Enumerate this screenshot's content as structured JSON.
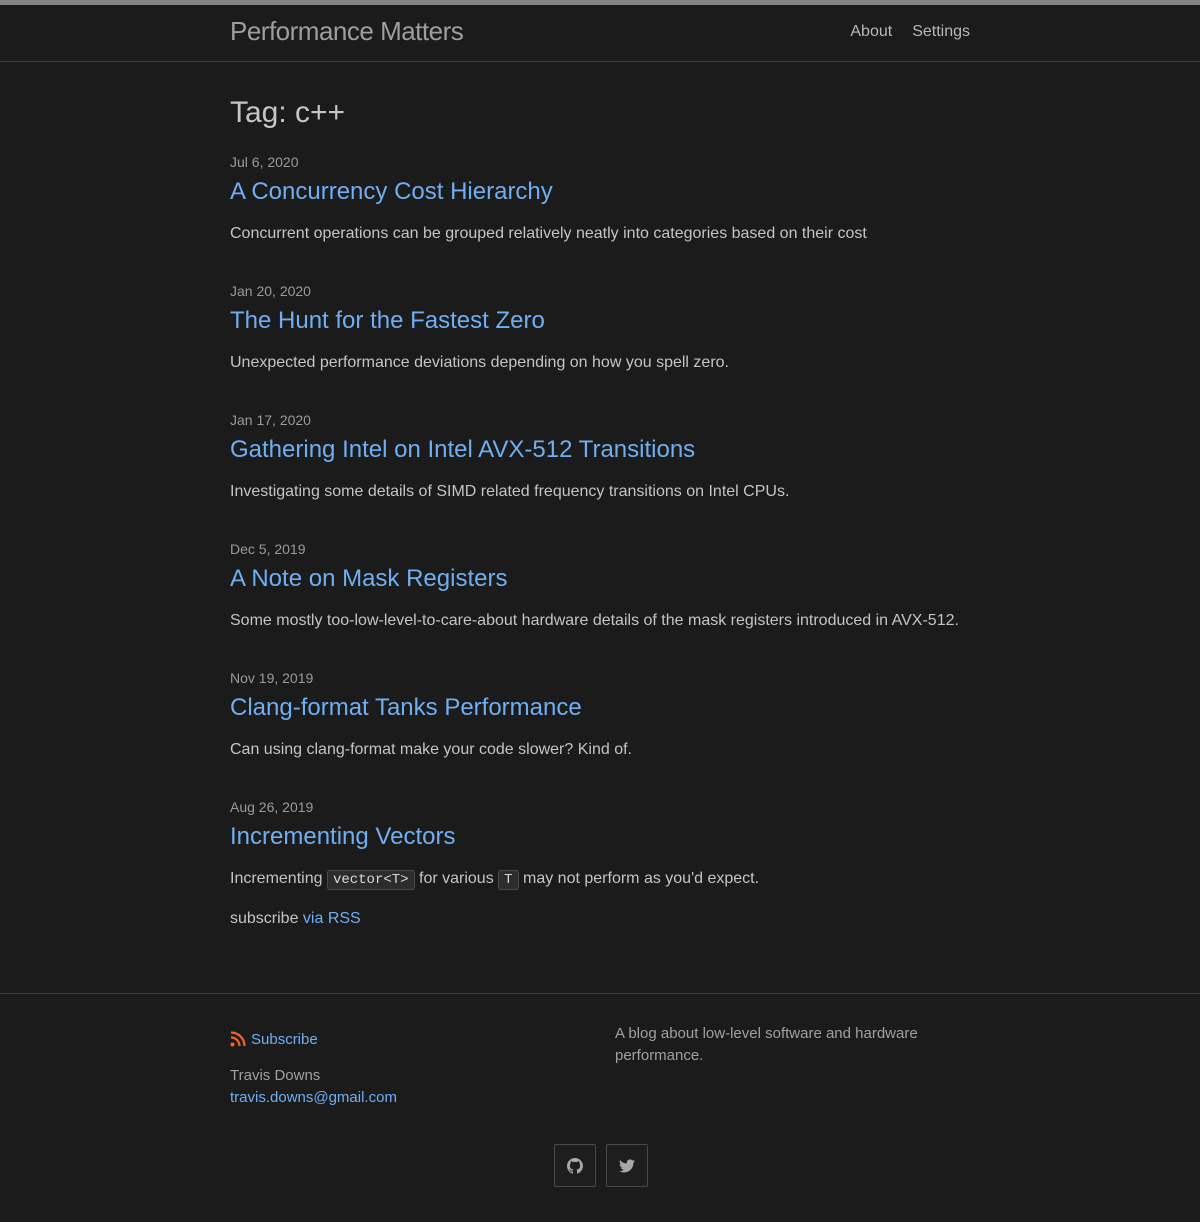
{
  "site": {
    "title": "Performance Matters"
  },
  "nav": [
    {
      "label": "About"
    },
    {
      "label": "Settings"
    }
  ],
  "page": {
    "heading": "Tag: c++"
  },
  "posts": [
    {
      "date": "Jul 6, 2020",
      "title": "A Concurrency Cost Hierarchy",
      "excerpt": "Concurrent operations can be grouped relatively neatly into categories based on their cost"
    },
    {
      "date": "Jan 20, 2020",
      "title": "The Hunt for the Fastest Zero",
      "excerpt": "Unexpected performance deviations depending on how you spell zero."
    },
    {
      "date": "Jan 17, 2020",
      "title": "Gathering Intel on Intel AVX-512 Transitions",
      "excerpt": "Investigating some details of SIMD related frequency transitions on Intel CPUs."
    },
    {
      "date": "Dec 5, 2019",
      "title": "A Note on Mask Registers",
      "excerpt": "Some mostly too-low-level-to-care-about hardware details of the mask registers introduced in AVX-512."
    },
    {
      "date": "Nov 19, 2019",
      "title": "Clang-format Tanks Performance",
      "excerpt": "Can using clang-format make your code slower? Kind of."
    },
    {
      "date": "Aug 26, 2019",
      "title": "Incrementing Vectors",
      "excerpt_parts": {
        "before": "Incrementing ",
        "code1": "vector<T>",
        "middle": " for various ",
        "code2": "T",
        "after": " may not perform as you'd expect."
      }
    }
  ],
  "rss": {
    "prefix": "subscribe ",
    "link": "via RSS"
  },
  "footer": {
    "subscribe_label": "Subscribe",
    "author_name": "Travis Downs",
    "author_email": "travis.downs@gmail.com",
    "description": "A blog about low-level software and hardware performance.",
    "social": [
      {
        "icon": "github-icon"
      },
      {
        "icon": "twitter-icon"
      }
    ],
    "rss_icon_color": "#f26522"
  },
  "colors": {
    "background": "#1b1b1b",
    "link": "#70aef2",
    "text": "#c8c8c8"
  }
}
